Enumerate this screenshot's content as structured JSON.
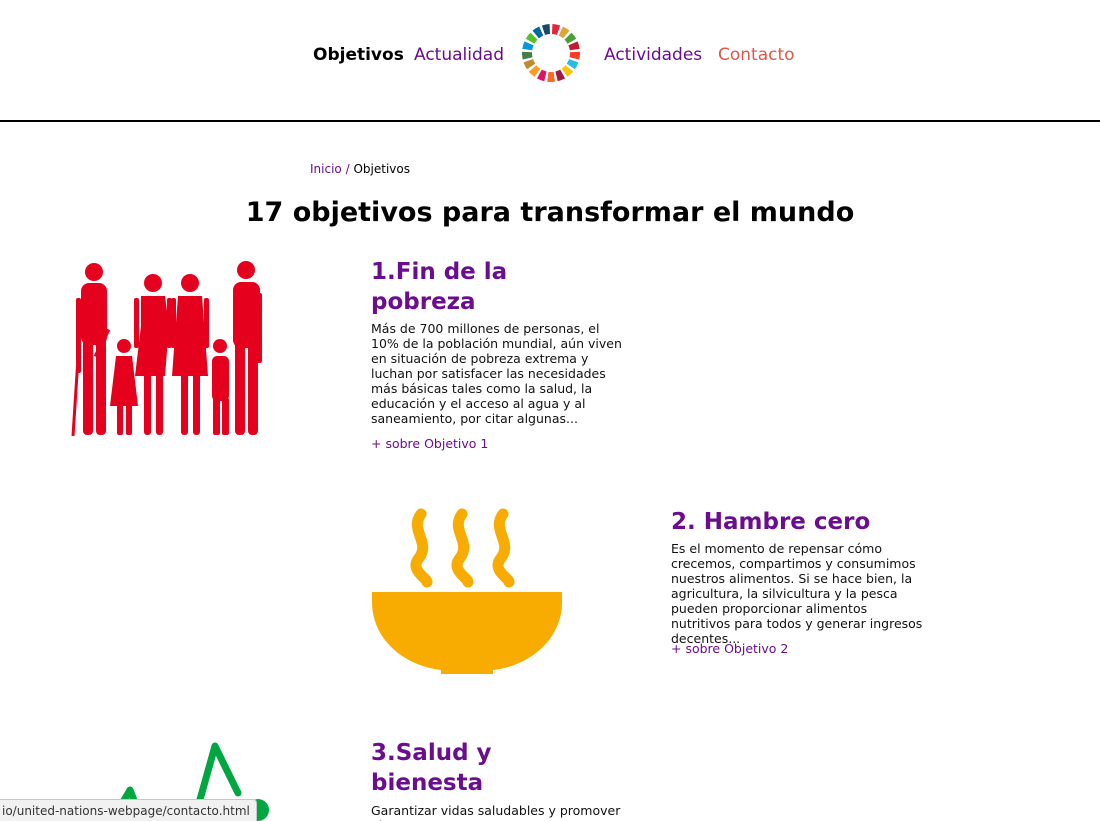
{
  "nav": {
    "objetivos": "Objetivos",
    "actualidad": "Actualidad",
    "actividades": "Actividades",
    "contacto": "Contacto",
    "logo_icon": "sdg-color-wheel-icon"
  },
  "breadcrumb": {
    "home": "Inicio",
    "separator": "/",
    "current": "Objetivos"
  },
  "page_title": "17 objetivos para transformar el mundo",
  "goals": [
    {
      "title": "1.Fin de la pobreza",
      "description": "Más de 700 millones de personas, el 10% de la población mundial, aún viven en situación de pobreza extrema y luchan por satisfacer las necesidades más básicas tales como la salud, la educación y el acceso al agua y al saneamiento, por citar algunas...",
      "more_link": "+ sobre Objetivo 1",
      "icon": "family-people-icon",
      "color": "#e5001e"
    },
    {
      "title": "2. Hambre cero",
      "description": "Es el momento de repensar cómo crecemos, compartimos y consumimos nuestros alimentos. Si se hace bien, la agricultura, la silvicultura y la pesca pueden proporcionar alimentos nutritivos para todos y generar ingresos decentes...",
      "more_link": "+ sobre Objetivo 2",
      "icon": "steaming-bowl-icon",
      "color": "#f8ab00"
    },
    {
      "title": "3.Salud y bienesta",
      "description": "Garantizar vidas saludables y promover el",
      "icon": "heartbeat-icon",
      "color": "#00a640"
    }
  ],
  "status_bar": {
    "url": "io/united-nations-webpage/contacto.html"
  },
  "colors": {
    "accent_purple": "#6a0d8f",
    "contact_red": "#e0574a"
  }
}
